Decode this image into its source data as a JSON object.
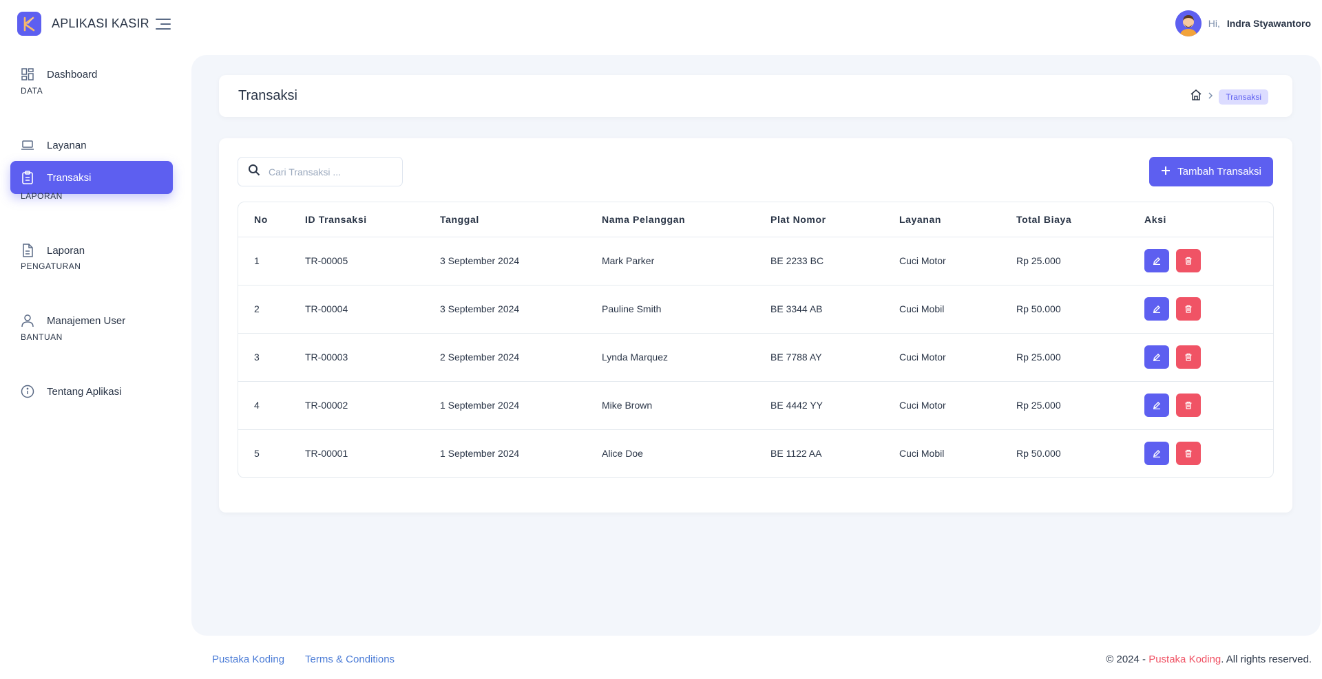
{
  "app": {
    "title": "APLIKASI KASIR"
  },
  "user": {
    "greeting": "Hi,",
    "name": "Indra Styawantoro"
  },
  "sidebar": {
    "items": [
      {
        "label": "Dashboard",
        "icon": "dashboard-icon"
      },
      {
        "section": "DATA"
      },
      {
        "label": "Layanan",
        "icon": "laptop-icon"
      },
      {
        "label": "Transaksi",
        "icon": "clipboard-icon",
        "active": true
      },
      {
        "section": "LAPORAN"
      },
      {
        "label": "Laporan",
        "icon": "file-text-icon"
      },
      {
        "section": "PENGATURAN"
      },
      {
        "label": "Manajemen User",
        "icon": "user-icon"
      },
      {
        "section": "BANTUAN"
      },
      {
        "label": "Tentang Aplikasi",
        "icon": "info-icon"
      }
    ]
  },
  "page": {
    "title": "Transaksi",
    "breadcrumb": {
      "home_icon": "home-icon",
      "current": "Transaksi"
    }
  },
  "toolbar": {
    "search_placeholder": "Cari Transaksi ...",
    "add_label": "Tambah Transaksi"
  },
  "table": {
    "headers": [
      "No",
      "ID Transaksi",
      "Tanggal",
      "Nama Pelanggan",
      "Plat Nomor",
      "Layanan",
      "Total Biaya",
      "Aksi"
    ],
    "rows": [
      [
        "1",
        "TR-00005",
        "3 September 2024",
        "Mark Parker",
        "BE 2233 BC",
        "Cuci Motor",
        "Rp 25.000"
      ],
      [
        "2",
        "TR-00004",
        "3 September 2024",
        "Pauline Smith",
        "BE 3344 AB",
        "Cuci Mobil",
        "Rp 50.000"
      ],
      [
        "3",
        "TR-00003",
        "2 September 2024",
        "Lynda Marquez",
        "BE 7788 AY",
        "Cuci Motor",
        "Rp 25.000"
      ],
      [
        "4",
        "TR-00002",
        "1 September 2024",
        "Mike Brown",
        "BE 4442 YY",
        "Cuci Motor",
        "Rp 25.000"
      ],
      [
        "5",
        "TR-00001",
        "1 September 2024",
        "Alice Doe",
        "BE 1122 AA",
        "Cuci Mobil",
        "Rp 50.000"
      ]
    ]
  },
  "footer": {
    "link1": "Pustaka Koding",
    "link2": "Terms & Conditions",
    "copy_prefix": "© 2024 - ",
    "copy_brand": "Pustaka Koding",
    "copy_suffix": ". All rights reserved."
  },
  "colors": {
    "accent": "#5d5ff0",
    "danger": "#f05365",
    "bg": "#f3f6fb"
  }
}
